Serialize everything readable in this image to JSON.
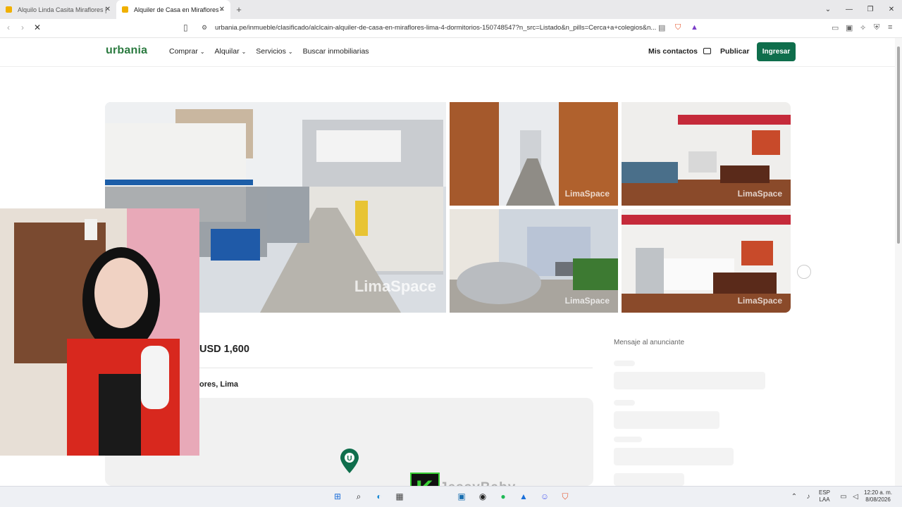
{
  "browser": {
    "tabs": [
      {
        "label": "Alquilo Linda Casita Miraflores |",
        "active": false
      },
      {
        "label": "Alquiler de Casa en Miraflores -",
        "active": true
      }
    ],
    "new_tab": "+",
    "url": "urbania.pe/inmueble/clasificado/alclcain-alquiler-de-casa-en-miraflores-lima-4-dormitorios-150748547?n_src=Listado&n_pills=Cerca+a+colegios&n..."
  },
  "site": {
    "logo": "urbania",
    "menu": [
      {
        "label": "Comprar",
        "chevron": "⌄"
      },
      {
        "label": "Alquilar",
        "chevron": "⌄"
      },
      {
        "label": "Servicios",
        "chevron": "⌄"
      },
      {
        "label": "Buscar inmobiliarias",
        "chevron": ""
      }
    ],
    "contacts_label": "Mis contactos",
    "publish_label": "Publicar",
    "login_label": "Ingresar",
    "accent": "#0f6e4c"
  },
  "gallery": {
    "watermark": "LimaSpace"
  },
  "listing": {
    "price": "USD 1,600",
    "location": "ores, Lima"
  },
  "sidebar": {
    "message_label": "Mensaje al anunciante"
  },
  "stream": {
    "overlay_text": "JessyBaby",
    "k_logo": "K"
  },
  "taskbar": {
    "lang_line1": "ESP",
    "lang_line2": "LAA",
    "time": "12:20 a. m.",
    "date": "8/08/2026"
  }
}
